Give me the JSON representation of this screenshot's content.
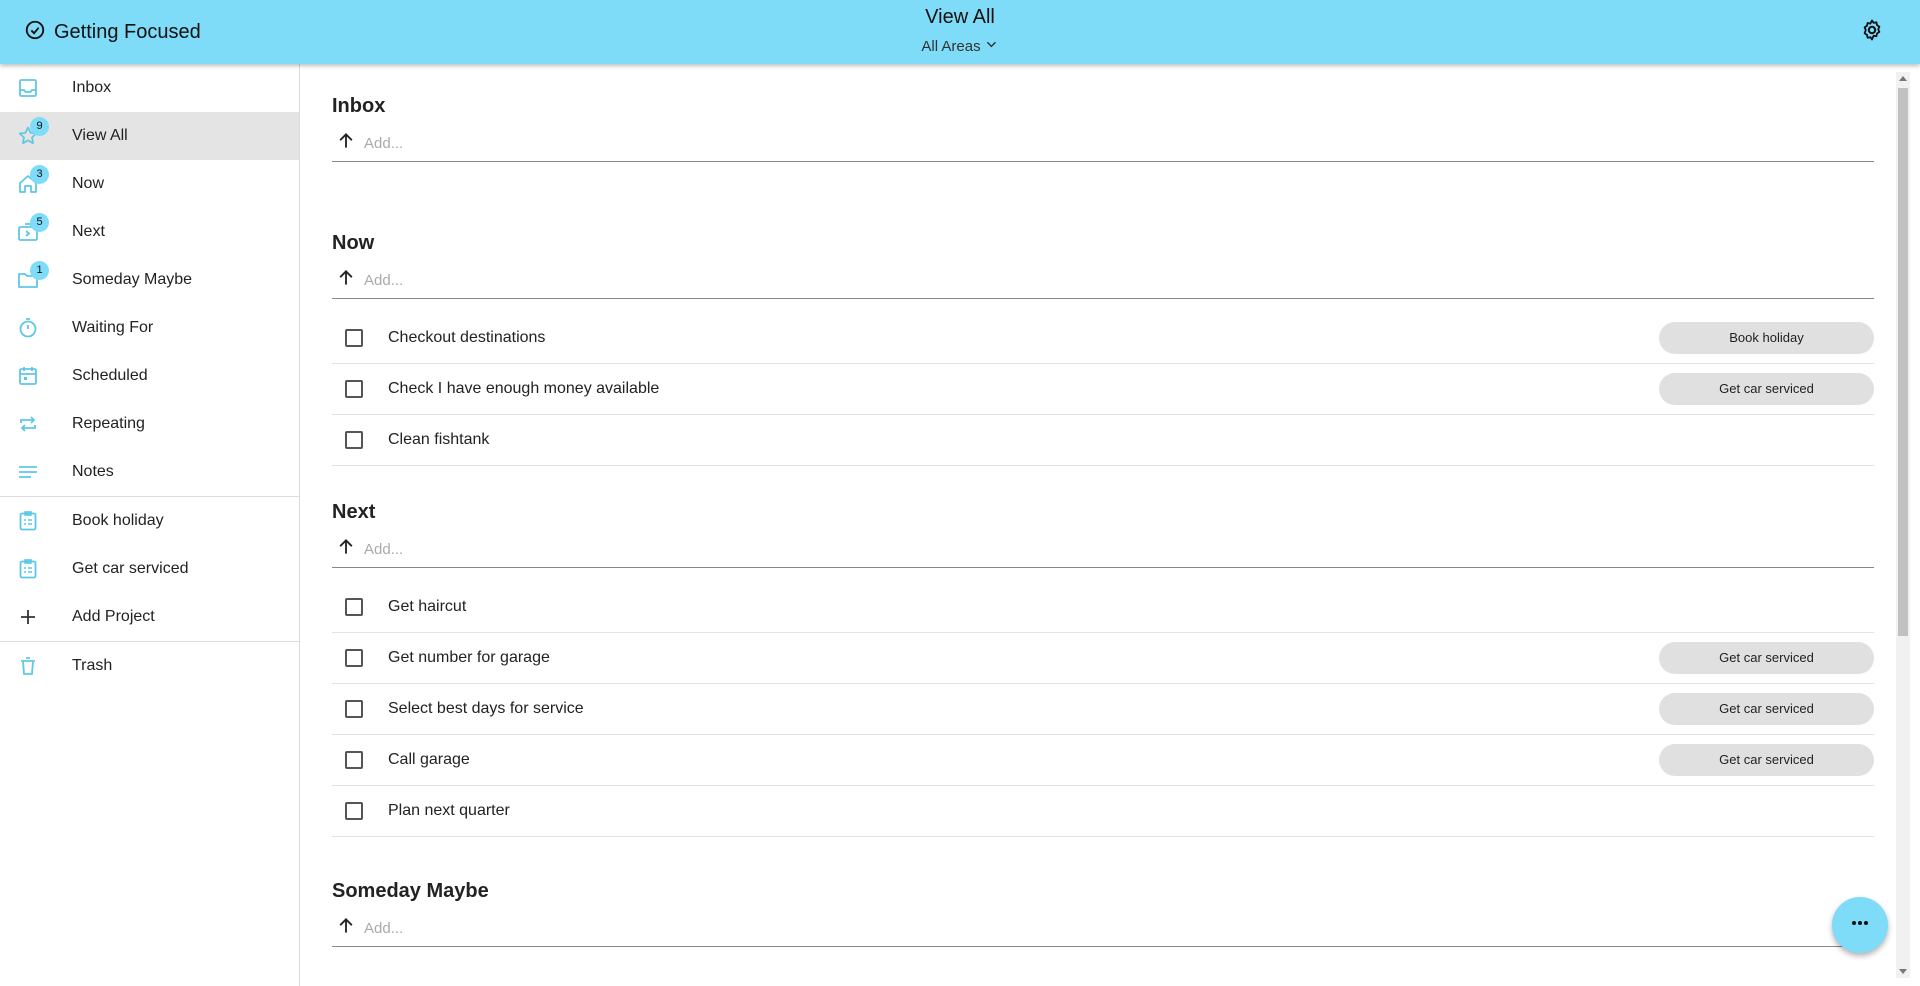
{
  "app": {
    "brand_title": "Getting Focused",
    "view_title": "View All",
    "area_filter": "All Areas",
    "accent_color": "#7fdcf8"
  },
  "sidebar": {
    "items": [
      {
        "label": "Inbox",
        "icon": "inbox-icon"
      },
      {
        "label": "View All",
        "icon": "star-icon",
        "badge": "9",
        "active": true
      },
      {
        "label": "Now",
        "icon": "home-icon",
        "badge": "3"
      },
      {
        "label": "Next",
        "icon": "next-box-icon",
        "badge": "5"
      },
      {
        "label": "Someday Maybe",
        "icon": "folder-icon",
        "badge": "1"
      },
      {
        "label": "Waiting For",
        "icon": "timer-icon"
      },
      {
        "label": "Scheduled",
        "icon": "calendar-icon"
      },
      {
        "label": "Repeating",
        "icon": "repeat-icon"
      },
      {
        "label": "Notes",
        "icon": "notes-icon"
      }
    ],
    "projects": [
      {
        "label": "Book holiday",
        "icon": "clipboard-icon"
      },
      {
        "label": "Get car serviced",
        "icon": "clipboard-icon"
      }
    ],
    "add_project_label": "Add Project",
    "trash_label": "Trash"
  },
  "main": {
    "add_placeholder": "Add...",
    "sections": [
      {
        "title": "Inbox",
        "tasks": []
      },
      {
        "title": "Now",
        "tasks": [
          {
            "label": "Checkout destinations",
            "project": "Book holiday"
          },
          {
            "label": "Check I have enough money available",
            "project": "Get car serviced"
          },
          {
            "label": "Clean fishtank",
            "project": ""
          }
        ]
      },
      {
        "title": "Next",
        "tasks": [
          {
            "label": "Get haircut",
            "project": ""
          },
          {
            "label": "Get number for garage",
            "project": "Get car serviced"
          },
          {
            "label": "Select best days for service",
            "project": "Get car serviced"
          },
          {
            "label": "Call garage",
            "project": "Get car serviced"
          },
          {
            "label": "Plan next quarter",
            "project": ""
          }
        ]
      },
      {
        "title": "Someday Maybe",
        "tasks": []
      }
    ]
  }
}
